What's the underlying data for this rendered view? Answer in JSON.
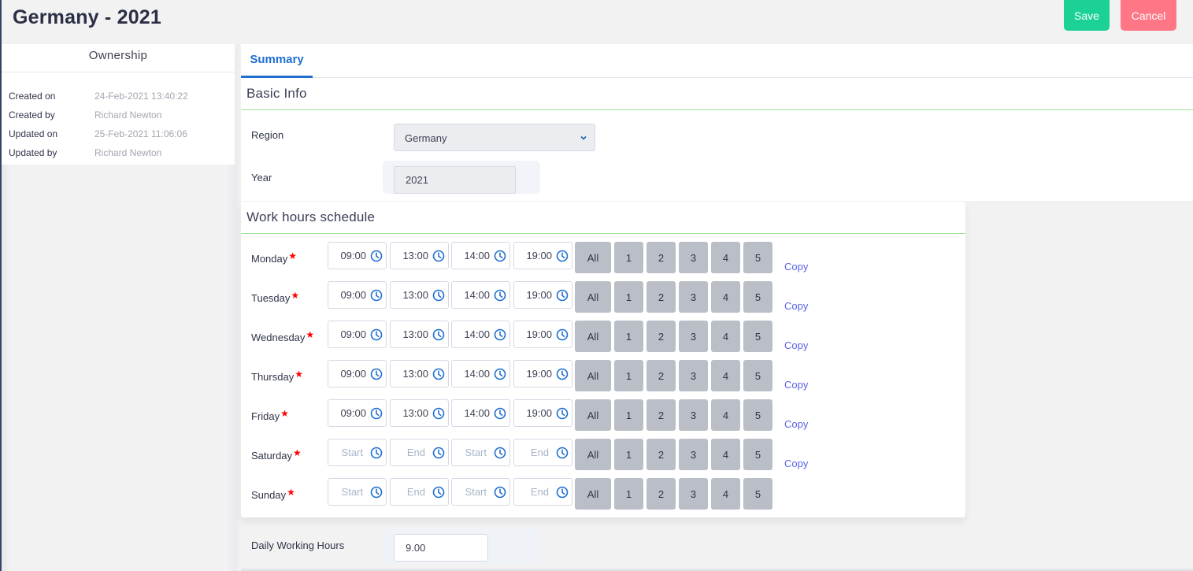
{
  "header": {
    "title": "Germany - 2021",
    "save_label": "Save",
    "cancel_label": "Cancel"
  },
  "colors": {
    "save": "#1bd196",
    "cancel": "#ff7687",
    "accent": "#1f6fd1",
    "required": "#ff0000",
    "link": "#5a62e8",
    "section_rule": "#9ee09a"
  },
  "ownership": {
    "title": "Ownership",
    "rows": [
      {
        "label": "Created on",
        "value": "24-Feb-2021 13:40:22"
      },
      {
        "label": "Created by",
        "value": "Richard Newton"
      },
      {
        "label": "Updated on",
        "value": "25-Feb-2021 11:06:06"
      },
      {
        "label": "Updated by",
        "value": "Richard Newton"
      }
    ]
  },
  "tabs": [
    {
      "label": "Summary",
      "active": true
    }
  ],
  "basic_info": {
    "title": "Basic Info",
    "region_label": "Region",
    "region_value": "Germany",
    "year_label": "Year",
    "year_value": "2021"
  },
  "schedule": {
    "title": "Work hours schedule",
    "placeholders": {
      "start": "Start",
      "end": "End"
    },
    "toggle_labels": [
      "All",
      "1",
      "2",
      "3",
      "4",
      "5"
    ],
    "copy_label": "Copy",
    "days": [
      {
        "name": "Monday",
        "required": true,
        "times": [
          "09:00",
          "13:00",
          "14:00",
          "19:00"
        ],
        "copy": true
      },
      {
        "name": "Tuesday",
        "required": true,
        "times": [
          "09:00",
          "13:00",
          "14:00",
          "19:00"
        ],
        "copy": true
      },
      {
        "name": "Wednesday",
        "required": true,
        "times": [
          "09:00",
          "13:00",
          "14:00",
          "19:00"
        ],
        "copy": true
      },
      {
        "name": "Thursday",
        "required": true,
        "times": [
          "09:00",
          "13:00",
          "14:00",
          "19:00"
        ],
        "copy": true
      },
      {
        "name": "Friday",
        "required": true,
        "times": [
          "09:00",
          "13:00",
          "14:00",
          "19:00"
        ],
        "copy": true
      },
      {
        "name": "Saturday",
        "required": true,
        "times": [
          "",
          "",
          "",
          ""
        ],
        "copy": true
      },
      {
        "name": "Sunday",
        "required": true,
        "times": [
          "",
          "",
          "",
          ""
        ],
        "copy": false
      }
    ]
  },
  "daily_hours": {
    "label": "Daily Working Hours",
    "value": "9.00"
  }
}
